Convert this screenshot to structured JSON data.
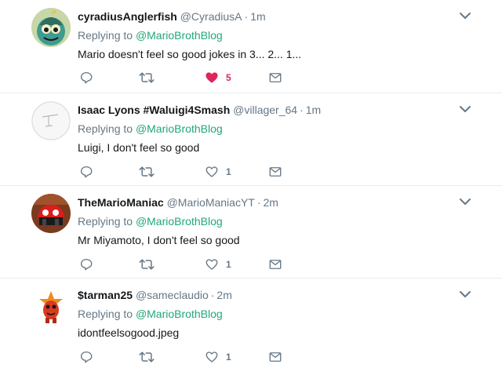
{
  "colors": {
    "link": "#20a878",
    "muted": "#657786",
    "like_active": "#e0245e",
    "divider": "#e6ecf0"
  },
  "icons": [
    "reply-icon",
    "retweet-icon",
    "heart-icon",
    "mail-icon",
    "chevron-down-icon"
  ],
  "tweets": [
    {
      "fullname": "cyradiusAnglerfish",
      "screenname": "@CyradiusA",
      "time": "1m",
      "replying_prefix": "Replying to",
      "replying_handle": "@MarioBrothBlog",
      "text": "Mario doesn't feel so good jokes in 3... 2... 1...",
      "likes": "5",
      "liked": true
    },
    {
      "fullname": "Isaac Lyons #Waluigi4Smash",
      "screenname": "@villager_64",
      "time": "1m",
      "replying_prefix": "Replying to",
      "replying_handle": "@MarioBrothBlog",
      "text": "Luigi, I don't feel so good",
      "likes": "1",
      "liked": false
    },
    {
      "fullname": "TheMarioManiac",
      "screenname": "@MarioManiacYT",
      "time": "2m",
      "replying_prefix": "Replying to",
      "replying_handle": "@MarioBrothBlog",
      "text": "Mr Miyamoto, I don't feel so good",
      "likes": "1",
      "liked": false
    },
    {
      "fullname": "$tarman25",
      "screenname": "@sameclaudio",
      "time": "2m",
      "replying_prefix": "Replying to",
      "replying_handle": "@MarioBrothBlog",
      "text": "idontfeelsogood.jpeg",
      "likes": "1",
      "liked": false
    }
  ]
}
